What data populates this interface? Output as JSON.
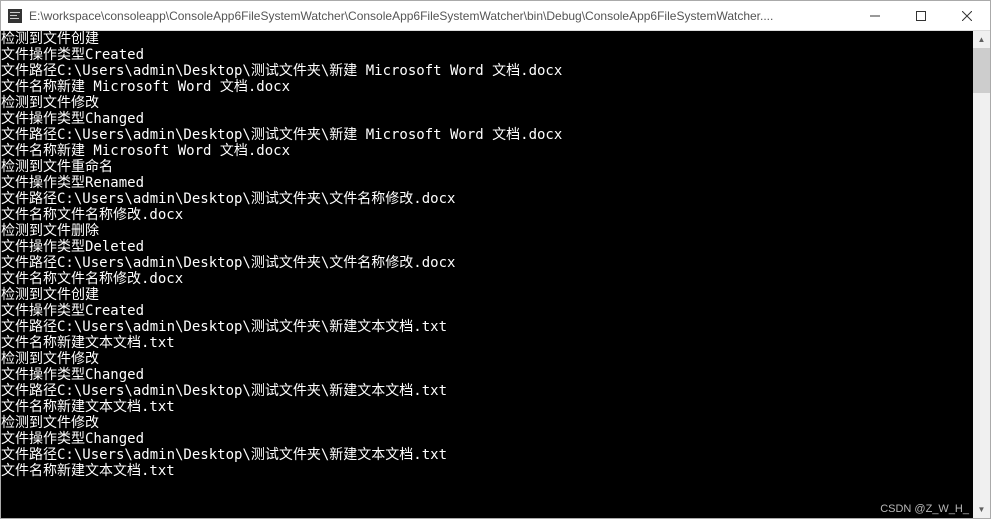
{
  "titlebar": {
    "title": "E:\\workspace\\consoleapp\\ConsoleApp6FileSystemWatcher\\ConsoleApp6FileSystemWatcher\\bin\\Debug\\ConsoleApp6FileSystemWatcher...."
  },
  "console": {
    "lines": [
      "检测到文件创建",
      "文件操作类型Created",
      "文件路径C:\\Users\\admin\\Desktop\\测试文件夹\\新建 Microsoft Word 文档.docx",
      "文件名称新建 Microsoft Word 文档.docx",
      "检测到文件修改",
      "文件操作类型Changed",
      "文件路径C:\\Users\\admin\\Desktop\\测试文件夹\\新建 Microsoft Word 文档.docx",
      "文件名称新建 Microsoft Word 文档.docx",
      "检测到文件重命名",
      "文件操作类型Renamed",
      "文件路径C:\\Users\\admin\\Desktop\\测试文件夹\\文件名称修改.docx",
      "文件名称文件名称修改.docx",
      "检测到文件删除",
      "文件操作类型Deleted",
      "文件路径C:\\Users\\admin\\Desktop\\测试文件夹\\文件名称修改.docx",
      "文件名称文件名称修改.docx",
      "检测到文件创建",
      "文件操作类型Created",
      "文件路径C:\\Users\\admin\\Desktop\\测试文件夹\\新建文本文档.txt",
      "文件名称新建文本文档.txt",
      "检测到文件修改",
      "文件操作类型Changed",
      "文件路径C:\\Users\\admin\\Desktop\\测试文件夹\\新建文本文档.txt",
      "文件名称新建文本文档.txt",
      "检测到文件修改",
      "文件操作类型Changed",
      "文件路径C:\\Users\\admin\\Desktop\\测试文件夹\\新建文本文档.txt",
      "文件名称新建文本文档.txt"
    ]
  },
  "watermark": "CSDN @Z_W_H_"
}
